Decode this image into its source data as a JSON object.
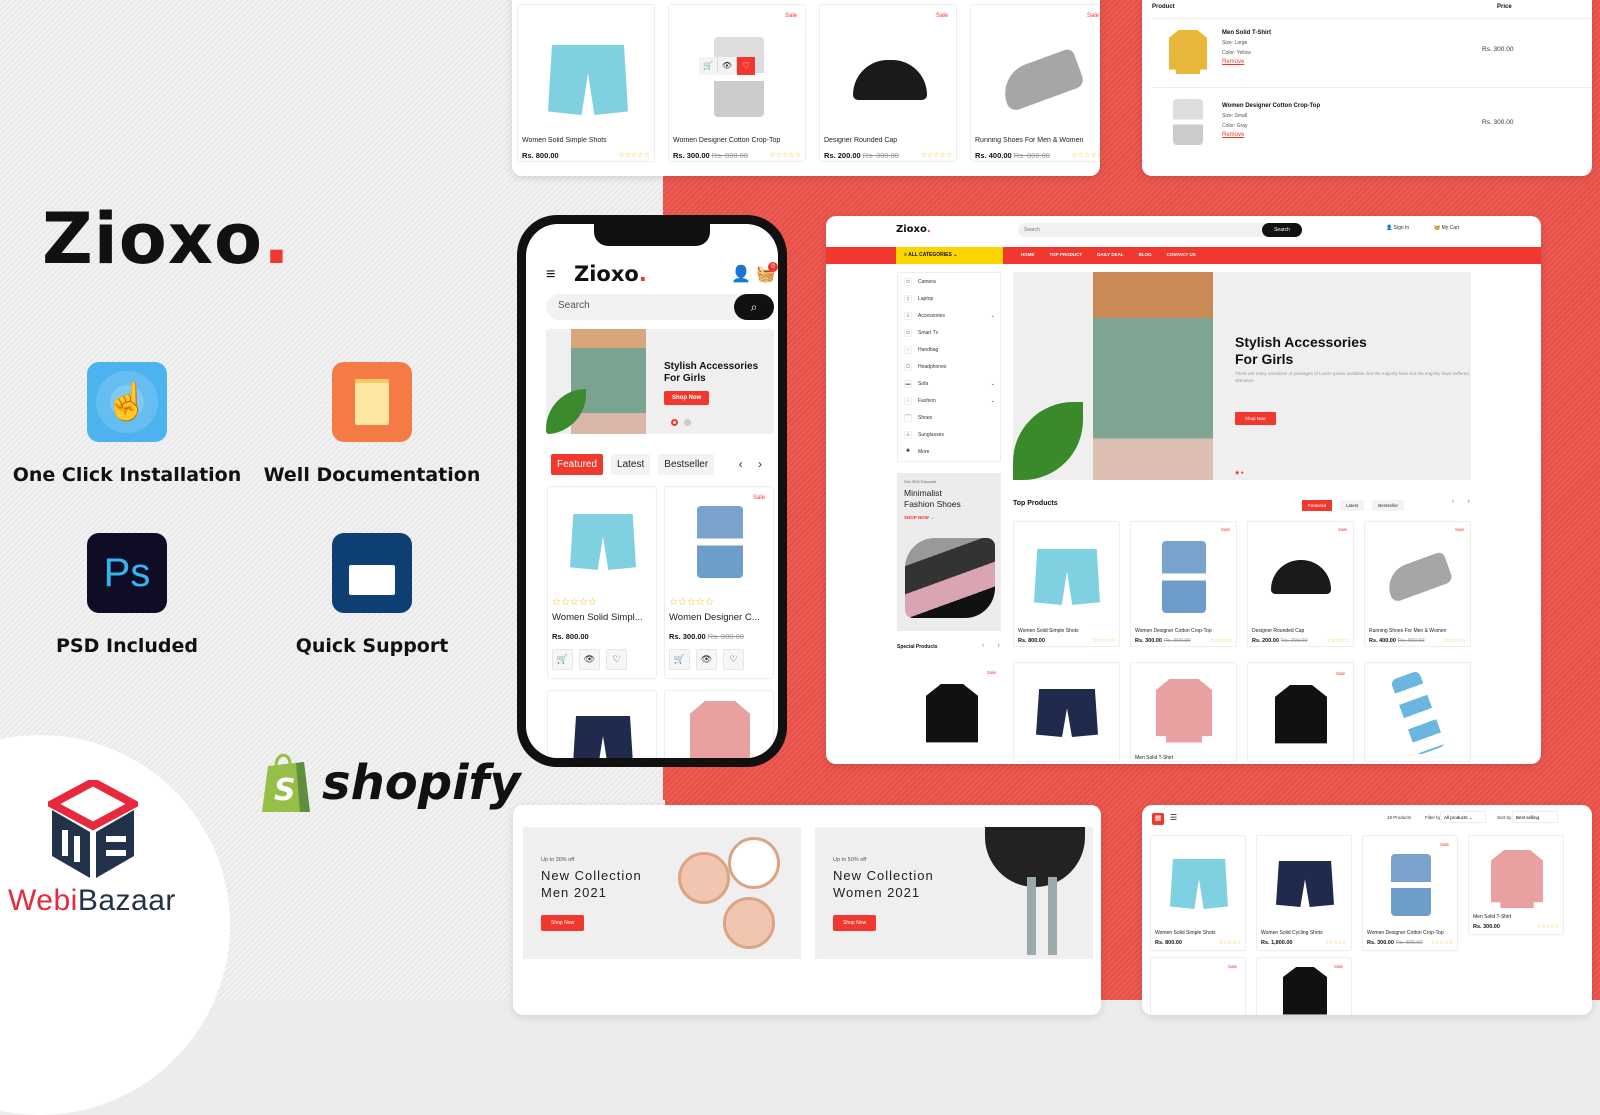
{
  "brand": {
    "name": "Zioxo",
    "dot": "."
  },
  "features": [
    {
      "label": "One Click Installation",
      "icon": "tap-hand-icon",
      "color": "#4db3ef"
    },
    {
      "label": "Well Documentation",
      "icon": "document-pencil-icon",
      "color": "#f47a46"
    },
    {
      "label": "PSD Included",
      "icon": "photoshop-icon",
      "glyph": "Ps",
      "color": "#0f0c25"
    },
    {
      "label": "Quick Support",
      "icon": "headset-monitor-icon",
      "color": "#0e3f73"
    }
  ],
  "vendor": {
    "name_a": "Webi",
    "name_b": "Bazaar"
  },
  "platform": {
    "name": "shopify",
    "bag_glyph": "S"
  },
  "colors": {
    "accent": "#f0382e",
    "yellow": "#fcd400",
    "dark": "#111111"
  },
  "top_strip": {
    "products": [
      {
        "name": "Women Solid Simple Shots",
        "price": "Rs. 800.00",
        "old_price": "",
        "sale": "",
        "stars": "☆☆☆☆☆"
      },
      {
        "name": "Women Designer Cotton Crop-Top",
        "price": "Rs. 300.00",
        "old_price": "Rs. 800.00",
        "sale": "Sale",
        "stars": "☆☆☆☆☆"
      },
      {
        "name": "Designer Rounded Cap",
        "price": "Rs. 200.00",
        "old_price": "Rs. 300.00",
        "sale": "Sale",
        "stars": "☆☆☆☆☆"
      },
      {
        "name": "Running Shoes For Men & Women",
        "price": "Rs. 400.00",
        "old_price": "Rs. 800.00",
        "sale": "Sale",
        "stars": "☆☆☆☆☆"
      }
    ],
    "hover_actions": [
      "🛒",
      "👁",
      "♡"
    ]
  },
  "cart": {
    "col_product": "Product",
    "col_price": "Price",
    "items": [
      {
        "name": "Men Solid T-Shirt",
        "size": "Size: Large",
        "color": "Color: Yellow",
        "remove": "Remove",
        "price": "Rs. 300.00"
      },
      {
        "name": "Women Designer Cotton Crop-Top",
        "size": "Size: Small",
        "color": "Color: Gray",
        "remove": "Remove",
        "price": "Rs. 300.00"
      }
    ]
  },
  "mobile": {
    "logo": "Zioxo",
    "menu_icon": "≡",
    "user_icon": "👤",
    "cart_icon": "🧺",
    "cart_count": "0",
    "search_placeholder": "Search",
    "search_icon": "⌕",
    "banner_title_1": "Stylish Accessories",
    "banner_title_2": "For Girls",
    "banner_button": "Shop Now",
    "tabs": [
      "Featured",
      "Latest",
      "Bestseller"
    ],
    "arrows": "‹ ›",
    "products": [
      {
        "name": "Women Solid Simpl...",
        "price": "Rs. 800.00",
        "old_price": "",
        "sale": "",
        "stars": "☆☆☆☆☆"
      },
      {
        "name": "Women Designer C...",
        "price": "Rs. 300.00",
        "old_price": "Rs. 800.00",
        "sale": "Sale",
        "stars": "☆☆☆☆☆"
      }
    ],
    "actions": [
      "🛒",
      "👁",
      "♡"
    ]
  },
  "desktop": {
    "logo": "Zioxo",
    "search_placeholder": "Search",
    "search_button": "Search",
    "sign_in": "Sign In",
    "my_cart": "My Cart",
    "all_categories": "ALL CATEGORIES",
    "nav": [
      "HOME",
      "TOP PRODUCT",
      "DAILY DEAL",
      "BLOG",
      "CONTACT US"
    ],
    "categories": [
      {
        "label": "Camera",
        "expand": ""
      },
      {
        "label": "Laptop",
        "expand": ""
      },
      {
        "label": "Accessories",
        "expand": "⌄"
      },
      {
        "label": "Smart Tv",
        "expand": ""
      },
      {
        "label": "Handbag",
        "expand": ""
      },
      {
        "label": "Headphones",
        "expand": ""
      },
      {
        "label": "Sofa",
        "expand": "⌄"
      },
      {
        "label": "Fashion",
        "expand": "⌄"
      },
      {
        "label": "Shoes",
        "expand": ""
      },
      {
        "label": "Sunglasses",
        "expand": ""
      },
      {
        "label": "More",
        "expand": ""
      }
    ],
    "hero": {
      "title_1": "Stylish Accessories",
      "title_2": "For Girls",
      "text": "There are many variations of passages of Lorem Ipsum available, but the majority have but the majotity have suffered alteration",
      "button": "Shop Now",
      "dots": "◉ ●"
    },
    "promo": {
      "subtitle": "Get 30% Discount",
      "title_1": "Minimalist",
      "title_2": "Fashion Shoes",
      "link": "SHOP NOW →"
    },
    "top_products_title": "Top Products",
    "tabs": [
      "Featured",
      "Latest",
      "Bestseller"
    ],
    "arrows": "‹ ›",
    "special_title": "Special Products",
    "top_products": [
      {
        "name": "Women Solid Simple Shots",
        "price": "Rs. 800.00",
        "old_price": "",
        "sale": "",
        "stars": "☆☆☆☆☆"
      },
      {
        "name": "Women Designer Cotton Crop-Top",
        "price": "Rs. 300.00",
        "old_price": "Rs. 800.00",
        "sale": "Sale",
        "stars": "☆☆☆☆☆"
      },
      {
        "name": "Designer Rounded Cap",
        "price": "Rs. 200.00",
        "old_price": "Rs. 300.00",
        "sale": "Sale",
        "stars": "☆☆☆☆☆"
      },
      {
        "name": "Running Shoes For Men & Women",
        "price": "Rs. 400.00",
        "old_price": "Rs. 800.00",
        "sale": "Sale",
        "stars": "☆☆☆☆☆"
      }
    ],
    "second_row": [
      {
        "name": "",
        "sale": "Sale"
      },
      {
        "name": "",
        "sale": ""
      },
      {
        "name": "Men Solid T-Shirt",
        "sale": ""
      },
      {
        "name": "",
        "sale": "Sale"
      },
      {
        "name": "",
        "sale": ""
      }
    ]
  },
  "banners": [
    {
      "subtitle": "Up to 30% off",
      "title_1": "New Collection",
      "title_2": "Men 2021",
      "button": "Shop Now"
    },
    {
      "subtitle": "Up to 50% off",
      "title_1": "New Collection",
      "title_2": "Women 2021",
      "button": "Shop Now"
    }
  ],
  "collection": {
    "grid_icon": "▦",
    "list_icon": "☰",
    "count": "18 Products",
    "filter_label": "Filter by",
    "filter_value": "All products",
    "sort_label": "Sort by",
    "sort_value": "Best selling",
    "products": [
      {
        "name": "Women Solid Simple Shots",
        "price": "Rs. 800.00",
        "old_price": "",
        "sale": "",
        "stars": "☆☆☆☆☆"
      },
      {
        "name": "Women Solid Cycling Shots",
        "price": "Rs. 1,800.00",
        "old_price": "",
        "sale": "",
        "stars": "☆☆☆☆☆"
      },
      {
        "name": "Women Designer Cotton Crop-Top",
        "price": "Rs. 300.00",
        "old_price": "Rs. 800.00",
        "sale": "Sale",
        "stars": "☆☆☆☆☆"
      },
      {
        "name": "Men Solid T-Shirt",
        "price": "Rs. 300.00",
        "old_price": "",
        "sale": "",
        "stars": "☆☆☆☆☆"
      }
    ],
    "next_row_sale": [
      "Sale",
      "Sale"
    ]
  }
}
